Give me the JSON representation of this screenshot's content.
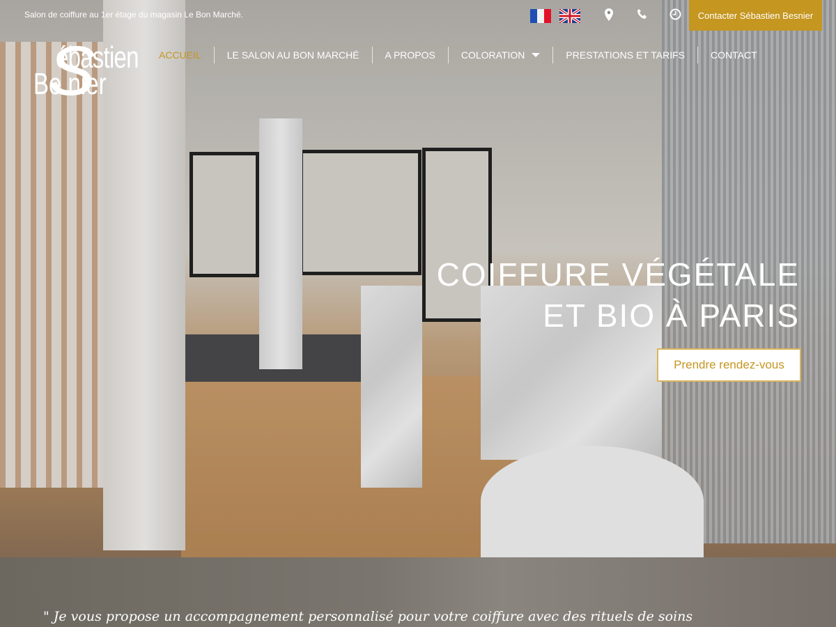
{
  "topbar": {
    "tagline": "Salon de coiffure au 1er étage du magasin Le Bon Marché.",
    "languages": [
      "fr-flag-icon",
      "uk-flag-icon"
    ],
    "icons": [
      "map-marker-icon",
      "phone-icon",
      "clock-icon"
    ],
    "contact_button": "Contacter Sébastien Besnier"
  },
  "logo": {
    "line1": "ébastien",
    "line2": "Be  nier",
    "initial": "S"
  },
  "nav": {
    "items": [
      {
        "label": "ACCUEIL",
        "active": true
      },
      {
        "label": "LE SALON AU BON MARCHÉ"
      },
      {
        "label": "A PROPOS"
      },
      {
        "label": "COLORATION",
        "dropdown": true
      },
      {
        "label": "PRESTATIONS ET TARIFS"
      },
      {
        "label": "CONTACT"
      }
    ]
  },
  "hero": {
    "line1": "COIFFURE VÉGÉTALE",
    "line2": "ET BIO À PARIS",
    "cta": "Prendre rendez-vous"
  },
  "quote": {
    "text": "\" Je vous propose un accompagnement personnalisé pour votre coiffure avec des rituels de soins"
  },
  "colors": {
    "accent": "#c59620"
  }
}
